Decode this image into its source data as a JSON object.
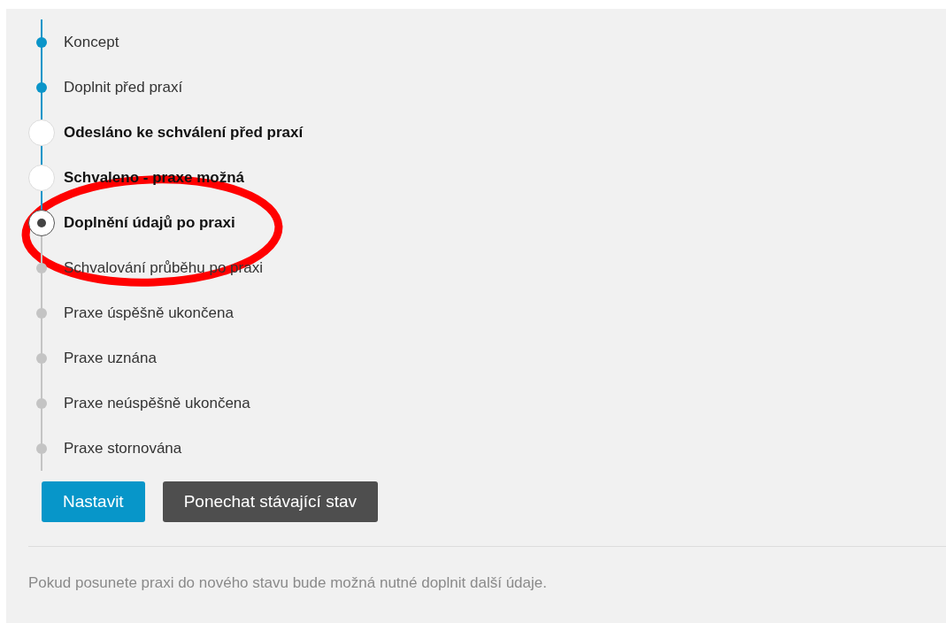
{
  "steps": [
    {
      "label": "Koncept",
      "kind": "done",
      "selected": false
    },
    {
      "label": "Doplnit před praxí",
      "kind": "done",
      "selected": false
    },
    {
      "label": "Odesláno ke schválení před praxí",
      "kind": "option",
      "selected": false
    },
    {
      "label": "Schvaleno - praxe možná",
      "kind": "option",
      "selected": false
    },
    {
      "label": "Doplnění údajů po praxi",
      "kind": "option",
      "selected": true
    },
    {
      "label": "Schvalování průběhu po praxi",
      "kind": "locked",
      "selected": false
    },
    {
      "label": "Praxe úspěšně ukončena",
      "kind": "locked",
      "selected": false
    },
    {
      "label": "Praxe uznána",
      "kind": "locked",
      "selected": false
    },
    {
      "label": "Praxe neúspěšně ukončena",
      "kind": "locked",
      "selected": false
    },
    {
      "label": "Praxe stornována",
      "kind": "locked",
      "selected": false
    }
  ],
  "buttons": [
    {
      "label": "Nastavit",
      "kind": "primary"
    },
    {
      "label": "Ponechat stávající stav",
      "kind": "secondary"
    }
  ],
  "note": "Pokud posunete praxi do nového stavu bude možná nutné doplnit další údaje."
}
